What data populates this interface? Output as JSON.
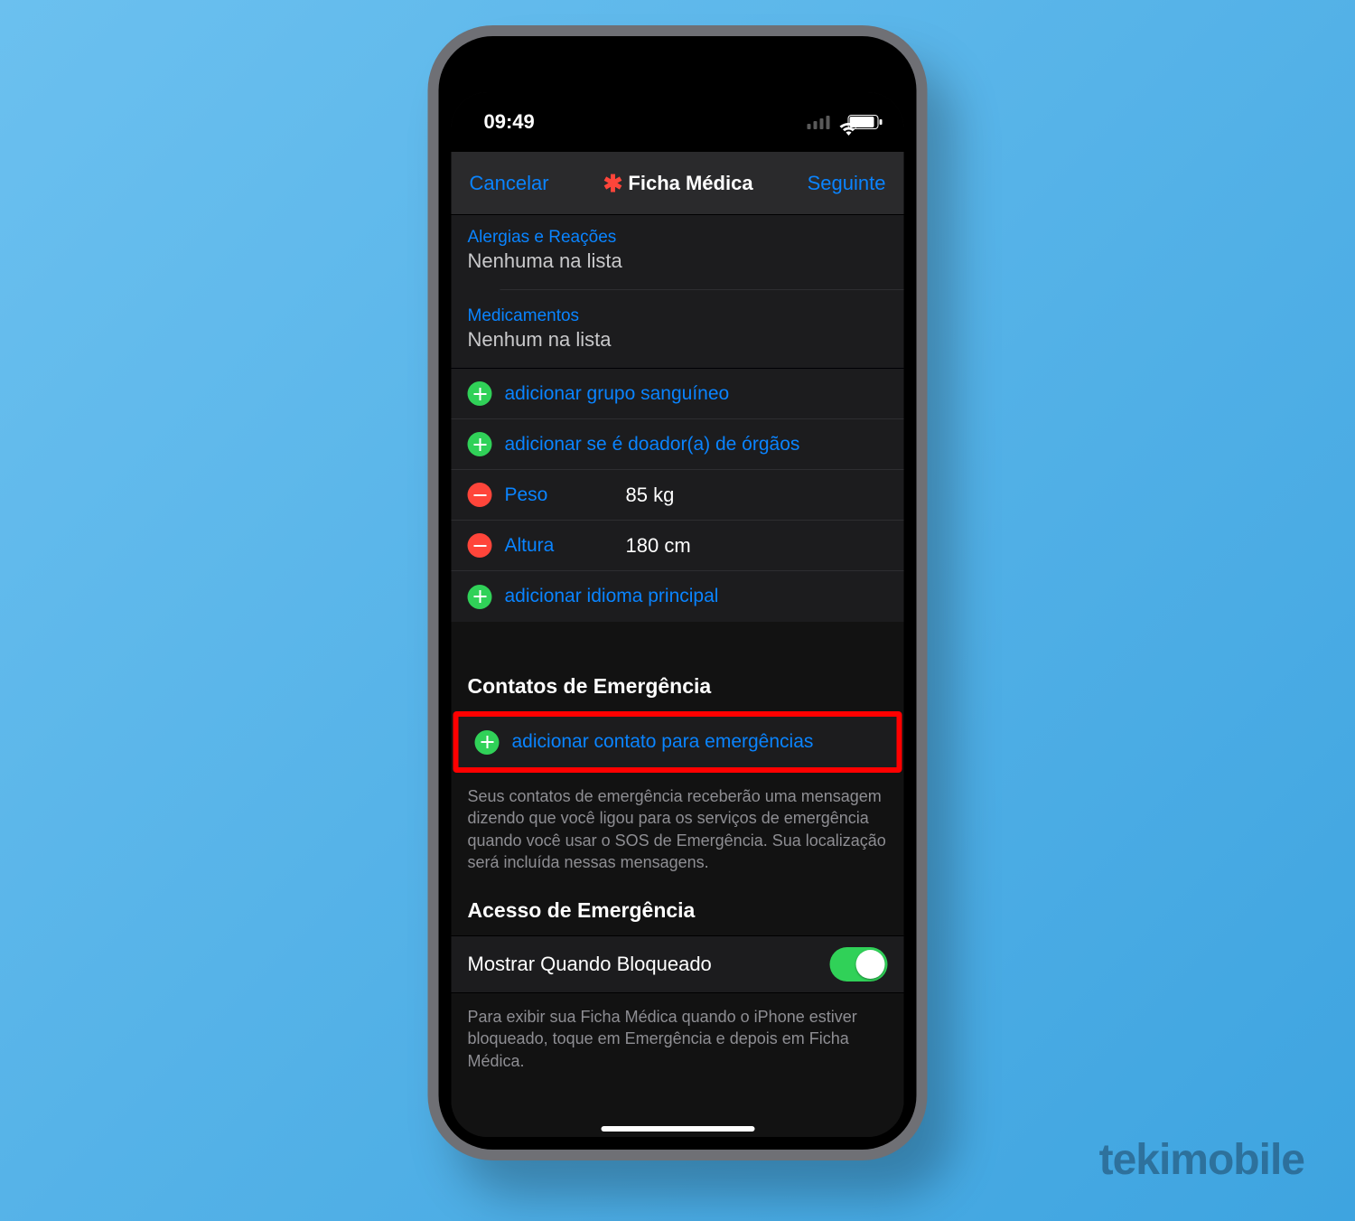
{
  "watermark": "tekimobile",
  "statusbar": {
    "time": "09:49"
  },
  "nav": {
    "cancel": "Cancelar",
    "title": "Ficha Médica",
    "next": "Seguinte"
  },
  "sections": {
    "allergies": {
      "label": "Alergias e Reações",
      "value": "Nenhuma na lista"
    },
    "medications": {
      "label": "Medicamentos",
      "value": "Nenhum na lista"
    }
  },
  "rows": {
    "add_blood_type": "adicionar grupo sanguíneo",
    "add_organ_donor": "adicionar se é doador(a) de órgãos",
    "weight_label": "Peso",
    "weight_value": "85 kg",
    "height_label": "Altura",
    "height_value": "180 cm",
    "add_language": "adicionar idioma principal"
  },
  "emergency_contacts": {
    "header": "Contatos de Emergência",
    "add": "adicionar contato para emergências",
    "note": "Seus contatos de emergência receberão uma mensagem dizendo que você ligou para os serviços de emergência quando você usar o SOS de Emergência. Sua localização será incluída nessas mensagens."
  },
  "emergency_access": {
    "header": "Acesso de Emergência",
    "toggle_label": "Mostrar Quando Bloqueado",
    "toggle_on": true,
    "note": "Para exibir sua Ficha Médica quando o iPhone estiver bloqueado, toque em Emergência e depois em Ficha Médica."
  }
}
